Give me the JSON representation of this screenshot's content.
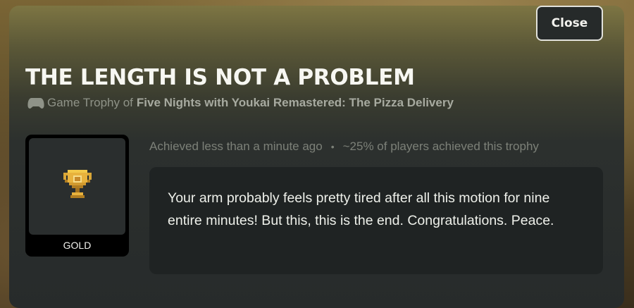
{
  "modal": {
    "close_label": "Close",
    "title": "THE LENGTH IS NOT A PROBLEM",
    "subtitle_prefix": "Game Trophy of",
    "game_name": "Five Nights with Youkai Remastered: The Pizza Delivery",
    "trophy": {
      "icon": "gold-trophy-icon",
      "tier": "GOLD"
    },
    "achieved_time": "Achieved less than a minute ago",
    "separator": "•",
    "achieved_percent": "~25% of players achieved this trophy",
    "description": "Your arm probably feels pretty tired after all this motion for nine entire minutes! But this, this is the end. Congratulations. Peace."
  },
  "colors": {
    "gold": "#d9a637",
    "panel": "#1f2323"
  }
}
